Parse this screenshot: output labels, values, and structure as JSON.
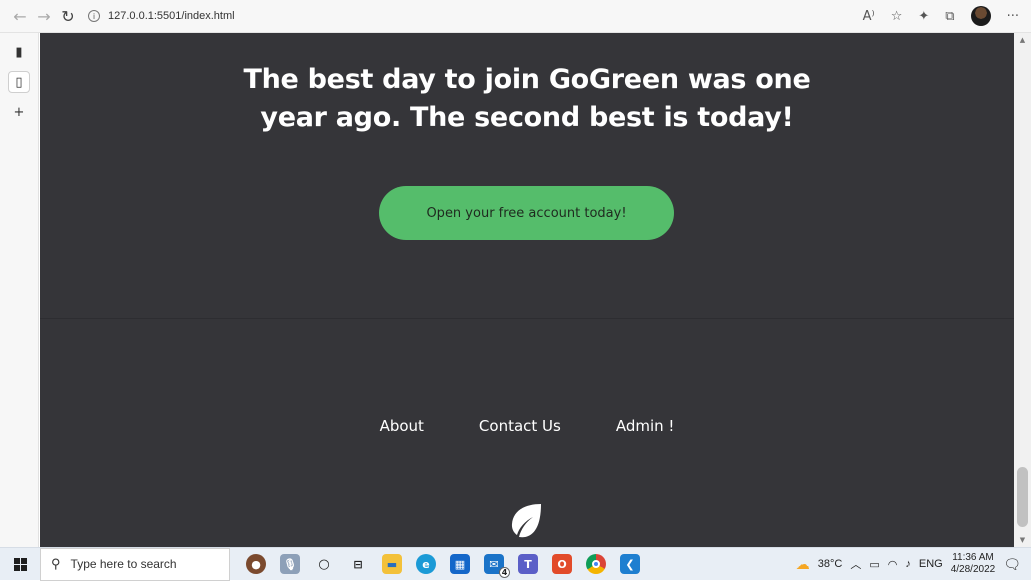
{
  "browser": {
    "url": "127.0.0.1:5501/index.html",
    "back_icon": "←",
    "forward_icon": "→",
    "refresh_icon": "↻",
    "info_icon": "i",
    "read_aloud_icon": "A⁾",
    "favorite_icon": "☆",
    "favorites_icon": "✦",
    "collections_icon": "⧉",
    "more_icon": "···"
  },
  "sidebar": {
    "tabs_icon": "▮",
    "page_icon": "▯",
    "add_icon": "+"
  },
  "page": {
    "hero_title_line1": "The best day to join GoGreen was one",
    "hero_title_line2": "year ago. The second best is today!",
    "cta_label": "Open your free account today!",
    "footer_links": [
      "About",
      "Contact Us",
      "Admin !"
    ],
    "colors": {
      "background": "#353539",
      "cta": "#55bd6b",
      "text": "#ffffff"
    }
  },
  "taskbar": {
    "search_placeholder": "Type here to search",
    "weather": "38°C",
    "language": "ENG",
    "time": "11:36 AM",
    "date": "4/28/2022",
    "mail_badge": "4"
  }
}
